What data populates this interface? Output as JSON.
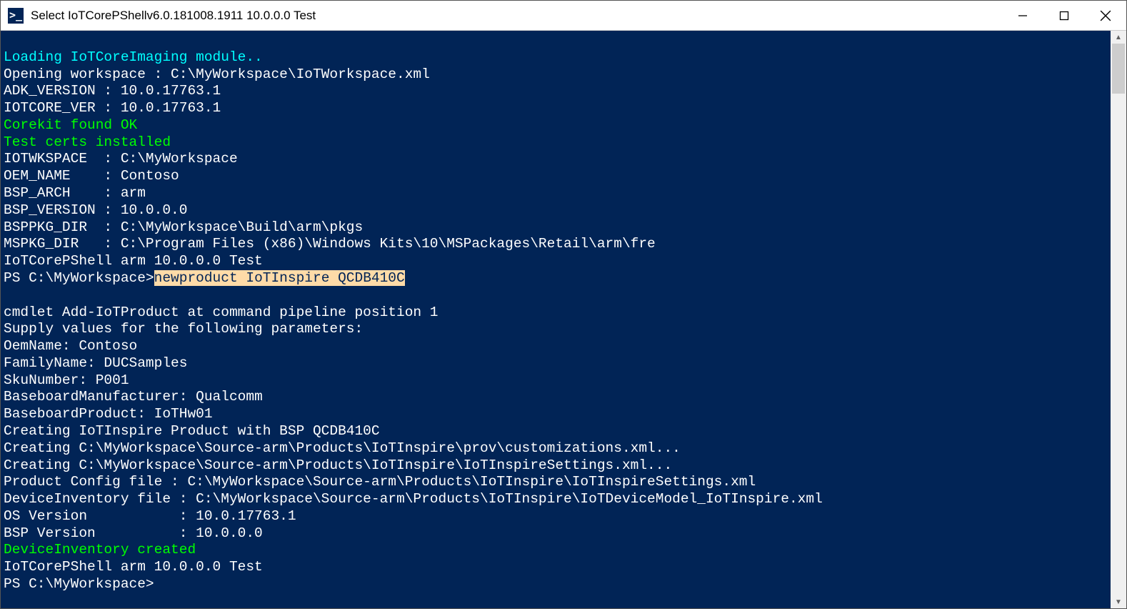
{
  "titlebar": {
    "icon_glyph": ">_",
    "title": "Select IoTCorePShellv6.0.181008.1911 10.0.0.0 Test"
  },
  "lines": {
    "l0": "Loading IoTCoreImaging module..",
    "l1": "Opening workspace : C:\\MyWorkspace\\IoTWorkspace.xml",
    "l2": "ADK_VERSION : 10.0.17763.1",
    "l3": "IOTCORE_VER : 10.0.17763.1",
    "l4": "Corekit found OK",
    "l5": "Test certs installed",
    "l6": "IOTWKSPACE  : C:\\MyWorkspace",
    "l7": "OEM_NAME    : Contoso",
    "l8": "BSP_ARCH    : arm",
    "l9": "BSP_VERSION : 10.0.0.0",
    "l10": "BSPPKG_DIR  : C:\\MyWorkspace\\Build\\arm\\pkgs",
    "l11": "MSPKG_DIR   : C:\\Program Files (x86)\\Windows Kits\\10\\MSPackages\\Retail\\arm\\fre",
    "l12": "IoTCorePShell arm 10.0.0.0 Test",
    "prompt1_pre": "PS C:\\MyWorkspace>",
    "prompt1_cmd1": "newproduct",
    "prompt1_cmd2": " IoTInspire QCDB410C",
    "l14": "",
    "l15": "cmdlet Add-IoTProduct at command pipeline position 1",
    "l16": "Supply values for the following parameters:",
    "l17": "OemName: Contoso",
    "l18": "FamilyName: DUCSamples",
    "l19": "SkuNumber: P001",
    "l20": "BaseboardManufacturer: Qualcomm",
    "l21": "BaseboardProduct: IoTHw01",
    "l22": "Creating IoTInspire Product with BSP QCDB410C",
    "l23": "Creating C:\\MyWorkspace\\Source-arm\\Products\\IoTInspire\\prov\\customizations.xml...",
    "l24": "Creating C:\\MyWorkspace\\Source-arm\\Products\\IoTInspire\\IoTInspireSettings.xml...",
    "l25": "Product Config file : C:\\MyWorkspace\\Source-arm\\Products\\IoTInspire\\IoTInspireSettings.xml",
    "l26": "DeviceInventory file : C:\\MyWorkspace\\Source-arm\\Products\\IoTInspire\\IoTDeviceModel_IoTInspire.xml",
    "l27": "OS Version           : 10.0.17763.1",
    "l28": "BSP Version          : 10.0.0.0",
    "l29": "DeviceInventory created",
    "l30": "IoTCorePShell arm 10.0.0.0 Test",
    "prompt2": "PS C:\\MyWorkspace>"
  }
}
